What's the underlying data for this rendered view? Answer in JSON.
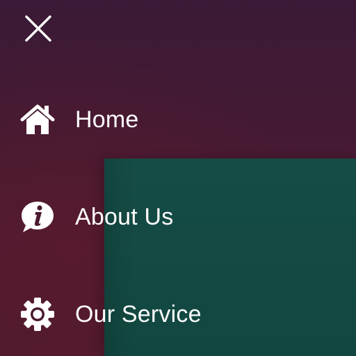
{
  "close": {
    "icon": "close-icon"
  },
  "menu": {
    "items": [
      {
        "label": "Home",
        "icon": "home-icon"
      },
      {
        "label": "About Us",
        "icon": "info-bubble-icon"
      },
      {
        "label": "Our Service",
        "icon": "gear-icon"
      }
    ]
  },
  "colors": {
    "background": "#421a33",
    "panel": "#154c46",
    "text": "#ffffff"
  }
}
